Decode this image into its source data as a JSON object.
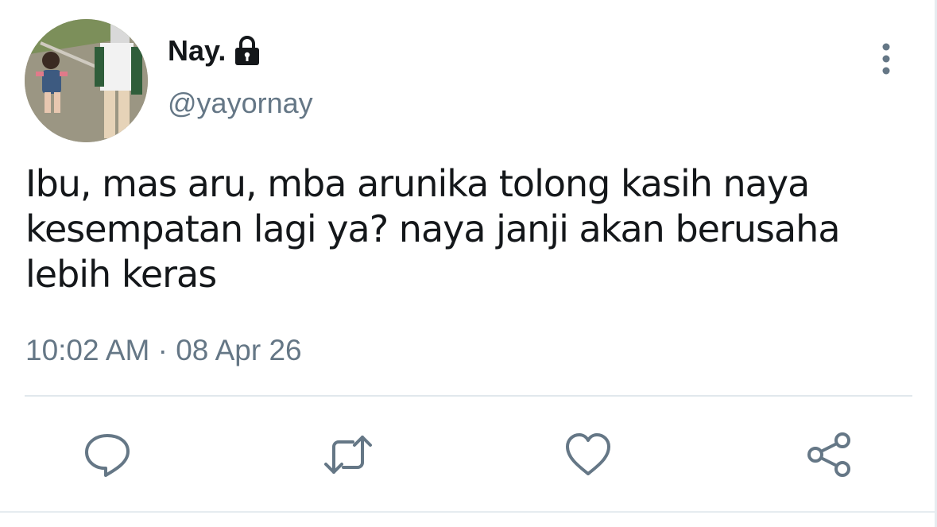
{
  "tweet": {
    "display_name": "Nay.",
    "username": "@yayornay",
    "text": "Ibu, mas aru, mba arunika tolong kasih naya kesempatan lagi ya? naya janji akan berusaha lebih keras",
    "timestamp": "10:02 AM · 08 Apr 26",
    "protected_icon": "lock-icon",
    "more_icon": "more-vertical-icon"
  },
  "actions": [
    {
      "name": "reply",
      "icon": "reply-icon"
    },
    {
      "name": "retweet",
      "icon": "retweet-icon"
    },
    {
      "name": "like",
      "icon": "heart-icon"
    },
    {
      "name": "share",
      "icon": "share-icon"
    }
  ],
  "colors": {
    "text_primary": "#14171a",
    "text_secondary": "#657786",
    "icon": "#657786",
    "divider": "#e1e8ed"
  }
}
